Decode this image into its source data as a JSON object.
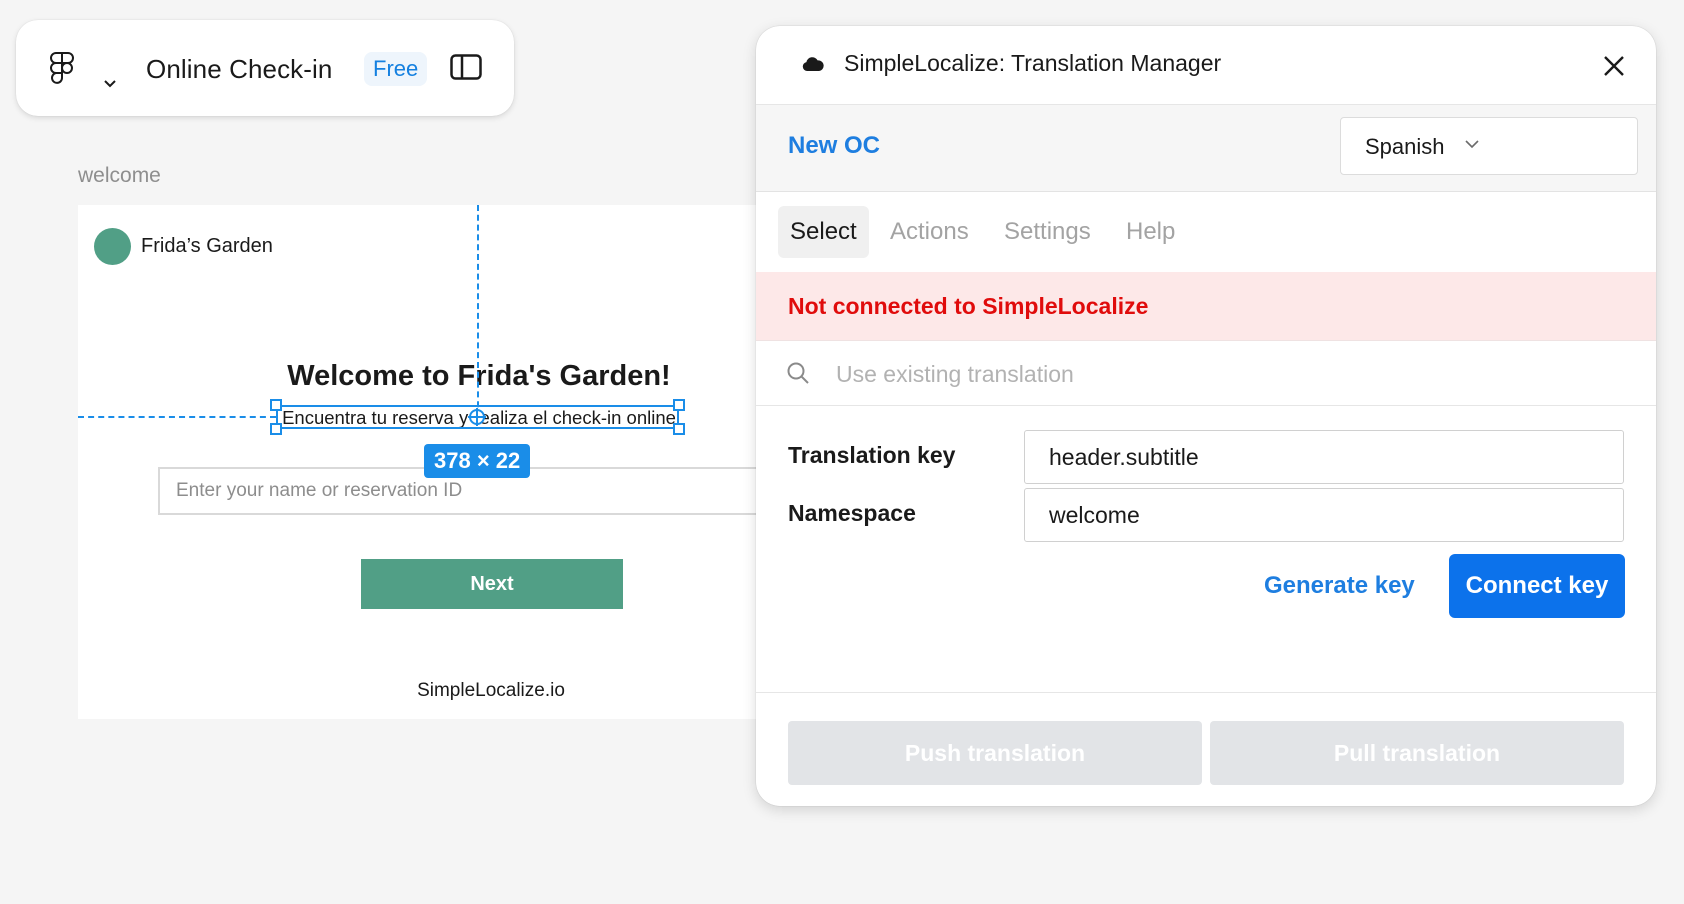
{
  "toolbar": {
    "file_title": "Online Check-in",
    "plan_badge": "Free"
  },
  "canvas": {
    "frame_label": "welcome",
    "brand_name": "Frida’s Garden",
    "heading": "Welcome to Frida's Garden!",
    "subtitle": "Encuentra tu reserva y realiza el check-in online",
    "input_placeholder": "Enter your name or reservation ID",
    "next_label": "Next",
    "footer_link": "SimpleLocalize.io",
    "brand_color": "#519f86"
  },
  "selection": {
    "size_label": "378 × 22",
    "accent_color": "#1a8de8"
  },
  "plugin": {
    "title": "SimpleLocalize: Translation Manager",
    "project_name": "New OC",
    "language": {
      "selected": "Spanish"
    },
    "tabs": [
      {
        "label": "Select",
        "active": true
      },
      {
        "label": "Actions",
        "active": false
      },
      {
        "label": "Settings",
        "active": false
      },
      {
        "label": "Help",
        "active": false
      }
    ],
    "alert": "Not connected to SimpleLocalize",
    "search_placeholder": "Use existing translation",
    "fields": {
      "key_label": "Translation key",
      "key_value": "header.subtitle",
      "namespace_label": "Namespace",
      "namespace_value": "welcome"
    },
    "generate_key_label": "Generate key",
    "connect_key_label": "Connect key",
    "push_label": "Push translation",
    "pull_label": "Pull translation",
    "primary_color": "#0c72eb",
    "error_color": "#e00c0c"
  }
}
